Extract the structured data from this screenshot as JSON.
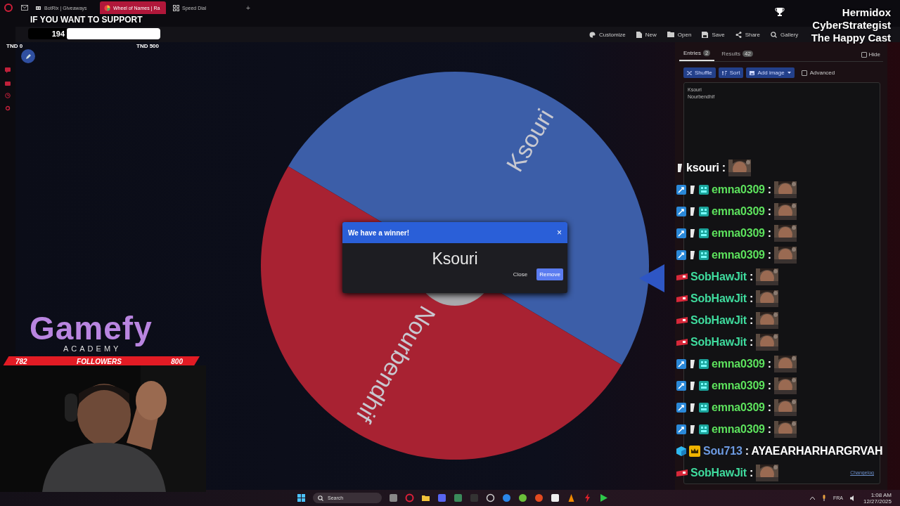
{
  "browser": {
    "tabs": [
      {
        "label": "BotRix | Giveaways",
        "selected": false
      },
      {
        "label": "Wheel of Names | Ra",
        "selected": true
      },
      {
        "label": "Speed Dial",
        "selected": false
      }
    ],
    "new_tab": "+"
  },
  "overlay": {
    "support_title": "IF YOU WANT TO SUPPORT",
    "goal_count": "194",
    "goal_min": "TND 0",
    "goal_max": "TND 500",
    "names": [
      "Hermidox",
      "CyberStrategist",
      "The Happy Cast"
    ],
    "logo": "Gamefy",
    "logo_sub": "ACADEMY",
    "followers": {
      "current": "782",
      "label": "FOLLOWERS",
      "target": "800"
    }
  },
  "toolbar": [
    {
      "label": "Customize"
    },
    {
      "label": "New"
    },
    {
      "label": "Open"
    },
    {
      "label": "Save"
    },
    {
      "label": "Share"
    },
    {
      "label": "Gallery"
    }
  ],
  "wheel": {
    "segments": [
      {
        "label": "Ksouri",
        "color": "#3c5ea8"
      },
      {
        "label": "Nourbendhif",
        "color": "#a82232"
      }
    ]
  },
  "dialog": {
    "title": "We have a winner!",
    "close_x": "×",
    "winner": "Ksouri",
    "buttons": [
      {
        "label": "Close",
        "kind": "text"
      },
      {
        "label": "Remove",
        "kind": "primary"
      }
    ]
  },
  "panel": {
    "tabs": [
      {
        "label": "Entries",
        "count": "2",
        "selected": true
      },
      {
        "label": "Results",
        "count": "42",
        "selected": false
      }
    ],
    "hide": {
      "label": "Hide",
      "checked": false
    },
    "actions": [
      {
        "label": "Shuffle"
      },
      {
        "label": "Sort"
      },
      {
        "label": "Add image"
      }
    ],
    "advanced": {
      "label": "Advanced",
      "checked": false
    },
    "entries": [
      "Ksouri",
      "Nourbendhif"
    ],
    "changelog": "Changelog"
  },
  "chat": [
    {
      "user": "ksouri",
      "color": "#ffffff",
      "kind": "plain",
      "text": ":",
      "emote": true
    },
    {
      "user": "emna0309",
      "color": "#5de25d",
      "kind": "vip",
      "text": ":",
      "emote": true
    },
    {
      "user": "emna0309",
      "color": "#5de25d",
      "kind": "vip",
      "text": ":",
      "emote": true
    },
    {
      "user": "emna0309",
      "color": "#5de25d",
      "kind": "vip",
      "text": ":",
      "emote": true
    },
    {
      "user": "emna0309",
      "color": "#5de25d",
      "kind": "vip",
      "text": ":",
      "emote": true
    },
    {
      "user": "SobHawJit",
      "color": "#3fdc9e",
      "kind": "flag",
      "text": ":",
      "emote": true
    },
    {
      "user": "SobHawJit",
      "color": "#3fdc9e",
      "kind": "flag",
      "text": ":",
      "emote": true
    },
    {
      "user": "SobHawJit",
      "color": "#3fdc9e",
      "kind": "flag",
      "text": ":",
      "emote": true
    },
    {
      "user": "SobHawJit",
      "color": "#3fdc9e",
      "kind": "flag",
      "text": ":",
      "emote": true
    },
    {
      "user": "emna0309",
      "color": "#5de25d",
      "kind": "vip",
      "text": ":",
      "emote": true
    },
    {
      "user": "emna0309",
      "color": "#5de25d",
      "kind": "vip",
      "text": ":",
      "emote": true
    },
    {
      "user": "emna0309",
      "color": "#5de25d",
      "kind": "vip",
      "text": ":",
      "emote": true
    },
    {
      "user": "emna0309",
      "color": "#5de25d",
      "kind": "vip",
      "text": ":",
      "emote": true
    },
    {
      "user": "Sou713",
      "color": "#6d9be2",
      "kind": "prime",
      "text": ": AYAEARHARHARGRVAH",
      "emote": false
    },
    {
      "user": "SobHawJit",
      "color": "#3fdc9e",
      "kind": "flag",
      "text": ":",
      "emote": true
    }
  ],
  "taskbar": {
    "search": "Search",
    "language": "FRA",
    "time": "1:08 AM",
    "date": "12/27/2025"
  }
}
